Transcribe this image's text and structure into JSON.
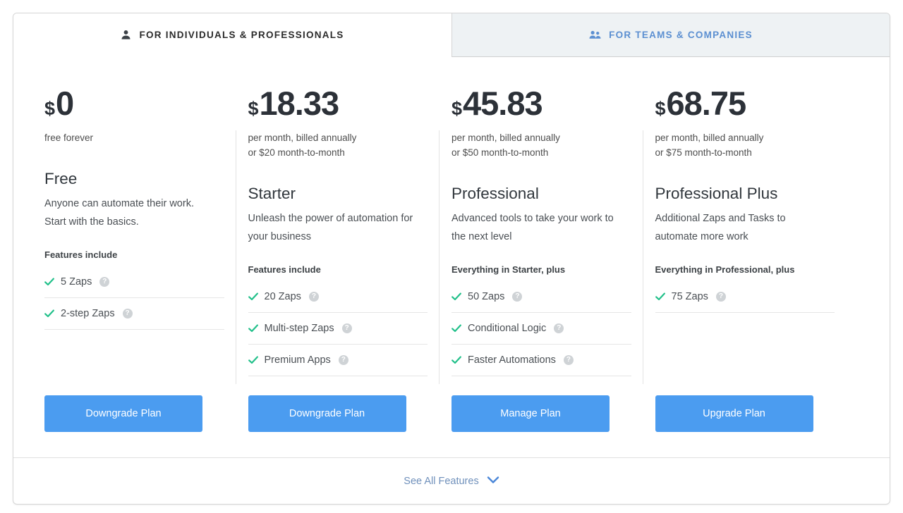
{
  "tabs": [
    {
      "label": "FOR INDIVIDUALS & PROFESSIONALS",
      "icon": "person-icon",
      "active": true
    },
    {
      "label": "FOR TEAMS & COMPANIES",
      "icon": "people-icon",
      "active": false
    }
  ],
  "colors": {
    "cta": "#4b9cf0",
    "check": "#22c08a",
    "tab_active_text": "#2b2b2b",
    "tab_inactive_text": "#5b8fd1",
    "link": "#6f90bb"
  },
  "plans": [
    {
      "currency": "$",
      "amount": "0",
      "billing_line_1": "free forever",
      "billing_line_2": "",
      "name": "Free",
      "description": "Anyone can automate their work. Start with the basics.",
      "features_heading": "Features include",
      "features": [
        {
          "label": "5 Zaps",
          "help": "?"
        },
        {
          "label": "2-step Zaps",
          "help": "?"
        }
      ],
      "cta_label": "Downgrade Plan"
    },
    {
      "currency": "$",
      "amount": "18.33",
      "billing_line_1": "per month, billed annually",
      "billing_line_2": "or $20 month-to-month",
      "name": "Starter",
      "description": "Unleash the power of automation for your business",
      "features_heading": "Features include",
      "features": [
        {
          "label": "20 Zaps",
          "help": "?"
        },
        {
          "label": "Multi-step Zaps",
          "help": "?"
        },
        {
          "label": "Premium Apps",
          "help": "?"
        }
      ],
      "cta_label": "Downgrade Plan"
    },
    {
      "currency": "$",
      "amount": "45.83",
      "billing_line_1": "per month, billed annually",
      "billing_line_2": "or $50 month-to-month",
      "name": "Professional",
      "description": "Advanced tools to take your work to the next level",
      "features_heading": "Everything in Starter, plus",
      "features": [
        {
          "label": "50 Zaps",
          "help": "?"
        },
        {
          "label": "Conditional Logic",
          "help": "?"
        },
        {
          "label": "Faster Automations",
          "help": "?"
        }
      ],
      "cta_label": "Manage Plan"
    },
    {
      "currency": "$",
      "amount": "68.75",
      "billing_line_1": "per month, billed annually",
      "billing_line_2": "or $75 month-to-month",
      "name": "Professional Plus",
      "description": "Additional Zaps and Tasks to automate more work",
      "features_heading": "Everything in Professional, plus",
      "features": [
        {
          "label": "75 Zaps",
          "help": "?"
        }
      ],
      "cta_label": "Upgrade Plan"
    }
  ],
  "footer": {
    "label": "See All Features",
    "icon": "chevron-down-icon"
  }
}
